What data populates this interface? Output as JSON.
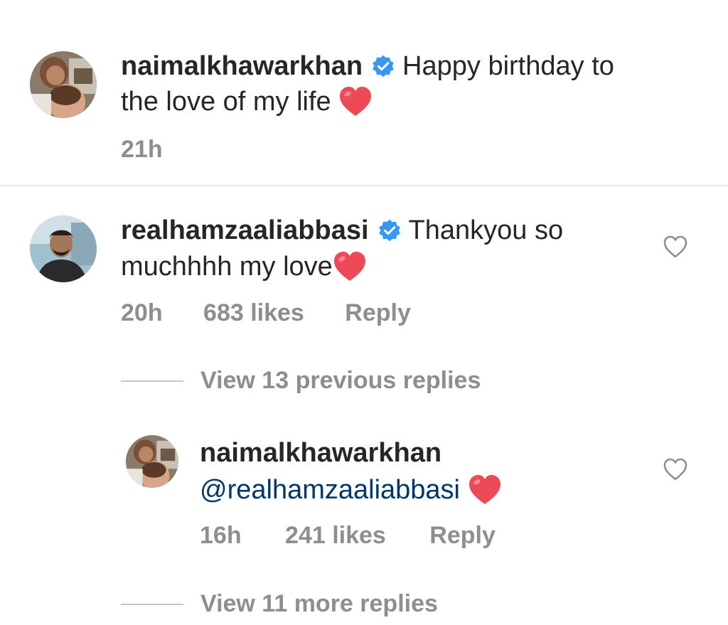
{
  "caption": {
    "username": "naimalkhawarkhan",
    "text_part1": "Happy birthday to",
    "text_part2": "the love of my life",
    "time": "21h"
  },
  "comment": {
    "username": "realhamzaaliabbasi",
    "text_part1": "Thankyou so",
    "text_part2": "muchhhh my love",
    "time": "20h",
    "likes": "683 likes",
    "reply_label": "Reply"
  },
  "view_previous": "View 13 previous replies",
  "reply": {
    "username": "naimalkhawarkhan",
    "mention": "@realhamzaaliabbasi",
    "time": "16h",
    "likes": "241 likes",
    "reply_label": "Reply"
  },
  "view_more": "View 11 more replies",
  "colors": {
    "verified": "#3897f0",
    "heart": "#ed4956",
    "mention": "#00376b",
    "meta_text": "#8e8e8e"
  },
  "icons": [
    "verified-badge-icon",
    "red-heart-emoji-icon",
    "heart-outline-icon"
  ]
}
